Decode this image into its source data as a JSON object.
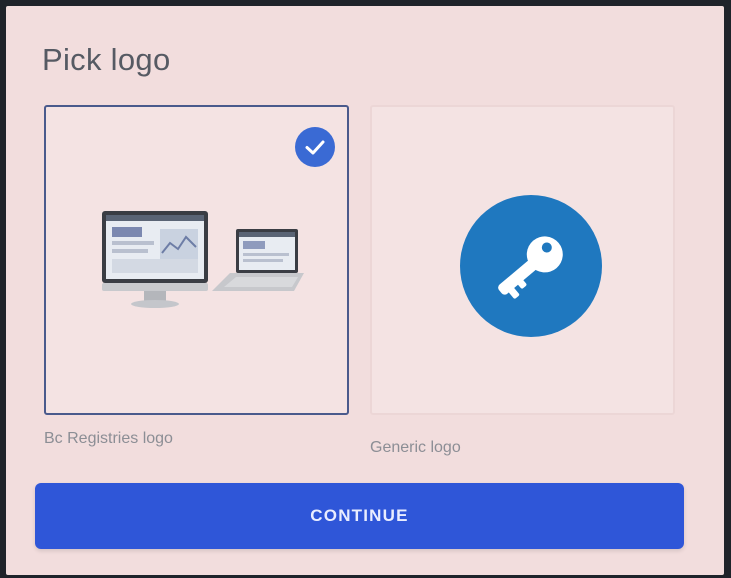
{
  "page": {
    "title": "Pick logo"
  },
  "logos": [
    {
      "caption": "Bc Registries logo",
      "selected": true,
      "icon": "computer-devices-illustration"
    },
    {
      "caption": "Generic logo",
      "selected": false,
      "icon": "key-icon"
    }
  ],
  "actions": {
    "continue_label": "CONTINUE"
  },
  "colors": {
    "screen_bg": "#f2dddd",
    "accent_blue": "#2f56d8",
    "check_blue": "#3a6ad4",
    "key_circle": "#1f78bf"
  }
}
